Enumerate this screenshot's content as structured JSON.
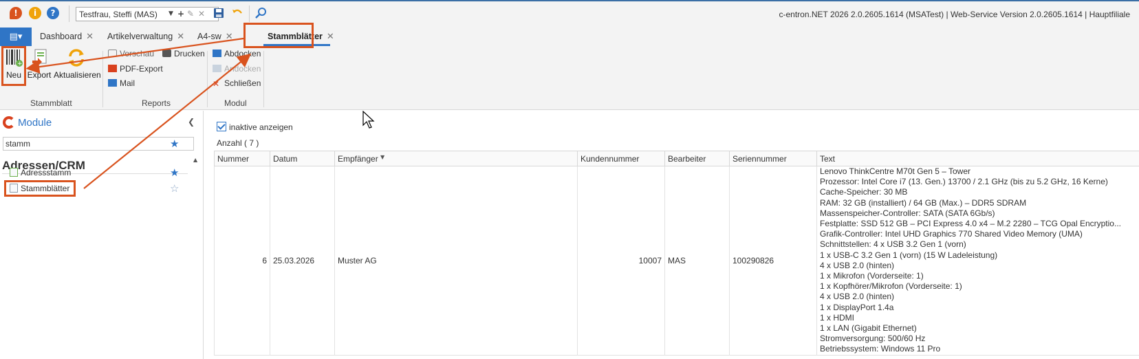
{
  "titlebar": {
    "user": "Testfrau, Steffi (MAS)",
    "info": "c-entron.NET 2026 2.0.2605.1614 (MSATest) | Web-Service Version 2.0.2605.1614 | Hauptfiliale",
    "icons": [
      "chat-icon",
      "info-icon",
      "help-icon",
      "dropdown-icon",
      "add-icon",
      "edit-icon",
      "clear-icon",
      "save-icon",
      "undo-icon",
      "search-icon"
    ],
    "colors": {
      "chat": "#d9531e",
      "info": "#f0a30a",
      "help": "#2f75c6"
    }
  },
  "tabs": [
    {
      "label": "Dashboard"
    },
    {
      "label": "Artikelverwaltung"
    },
    {
      "label": "A4-sw"
    },
    {
      "label": "Stammblätter"
    }
  ],
  "ribbon": {
    "groups": {
      "stammblatt": {
        "label": "Stammblatt",
        "new": "Neu",
        "export": "Export",
        "refresh": "Aktualisieren"
      },
      "reports": {
        "label": "Reports",
        "preview": "Vorschau",
        "print": "Drucken",
        "pdf": "PDF-Export",
        "mail": "Mail"
      },
      "modul": {
        "label": "Modul",
        "undock": "Abdocken",
        "dock": "Andocken",
        "close": "Schließen"
      }
    }
  },
  "sidebar": {
    "title": "Module",
    "search_value": "stamm",
    "section": "Adressen/CRM",
    "items": [
      {
        "label": "Adressstamm",
        "favorite": true
      },
      {
        "label": "Stammblätter",
        "favorite": false
      }
    ]
  },
  "main": {
    "show_inactive_label": "inaktive anzeigen",
    "count_label": "Anzahl ( 7 )",
    "columns": [
      "Nummer",
      "Datum",
      "Empfänger",
      "Kundennummer",
      "Bearbeiter",
      "Seriennummer",
      "Text"
    ],
    "rows": [
      {
        "nummer": "6",
        "datum": "25.03.2026",
        "empfaenger": "Muster AG",
        "kundennummer": "10007",
        "bearbeiter": "MAS",
        "seriennummer": "100290826",
        "text_lines": [
          "Lenovo ThinkCentre M70t Gen 5 – Tower",
          "Prozessor: Intel Core i7 (13. Gen.) 13700 / 2.1 GHz (bis zu 5.2 GHz, 16 Kerne)",
          "Cache-Speicher: 30 MB",
          "RAM: 32 GB (installiert) / 64 GB (Max.) – DDR5 SDRAM",
          "Massenspeicher-Controller: SATA (SATA 6Gb/s)",
          "Festplatte: SSD 512 GB – PCI Express 4.0 x4 – M.2 2280 – TCG Opal Encryptio...",
          "Grafik-Controller: Intel UHD Graphics 770 Shared Video Memory (UMA)",
          "Schnittstellen: 4 x USB 3.2 Gen 1 (vorn)",
          "1 x USB-C 3.2 Gen 1 (vorn) (15 W Ladeleistung)",
          "4 x USB 2.0 (hinten)",
          "1 x Mikrofon (Vorderseite: 1)",
          "1 x Kopfhörer/Mikrofon (Vorderseite: 1)",
          "4 x USB 2.0 (hinten)",
          "1 x DisplayPort 1.4a",
          "1 x HDMI",
          "1 x LAN (Gigabit Ethernet)",
          "Stromversorgung: 500/60 Hz",
          "Betriebssystem: Windows 11 Pro"
        ]
      }
    ]
  },
  "annotation_color": "#d9531e",
  "accent_color": "#2f75c6"
}
